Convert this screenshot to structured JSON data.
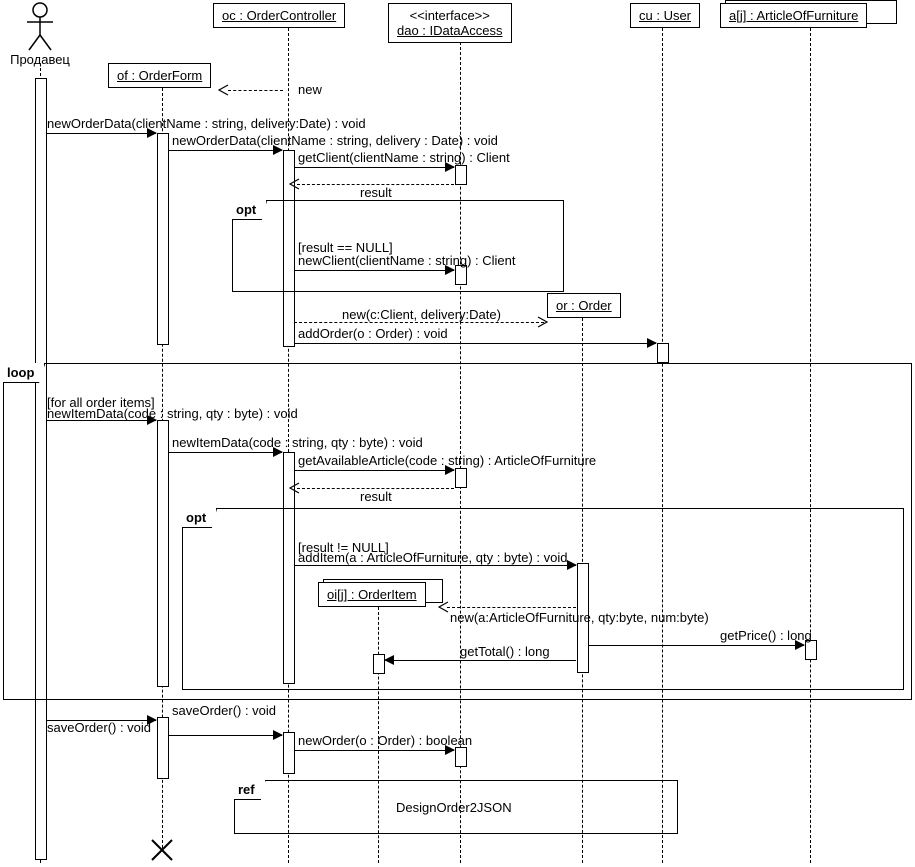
{
  "actor": {
    "label": "Продавец"
  },
  "lifelines": {
    "of": "of : OrderForm",
    "oc": "oc : OrderController",
    "dao_stereo": "<<interface>>",
    "dao": "dao : IDataAccess",
    "or": "or : Order",
    "cu": "cu : User",
    "aj": "a[j] : ArticleOfFurniture",
    "oij": "oi[j] : OrderItem"
  },
  "messages": {
    "m_new_of": "new",
    "m_newOrderData1": "newOrderData(clientName : string, delivery:Date) : void",
    "m_newOrderData2": "newOrderData(clientName : string, delivery : Date) : void",
    "m_getClient": "getClient(clientName : string) : Client",
    "m_result1": "result",
    "m_newClient": "newClient(clientName : string) : Client",
    "m_newOrder": "new(c:Client, delivery:Date)",
    "m_addOrder": "addOrder(o : Order) : void",
    "m_newItemData1": "newItemData(code : string, qty : byte) : void",
    "m_newItemData2": "newItemData(code : string, qty : byte) : void",
    "m_getAvailArt": "getAvailableArticle(code : string) : ArticleOfFurniture",
    "m_result2": "result",
    "m_addItem": "addItem(a : ArticleOfFurniture, qty : byte) : void",
    "m_newOI": "new(a:ArticleOfFurniture, qty:byte, num:byte)",
    "m_getPrice": "getPrice() : long",
    "m_getTotal": "getTotal() : long",
    "m_saveOrder1": "saveOrder() : void",
    "m_saveOrder2": "saveOrder() : void",
    "m_newOrderDao": "newOrder(o : Order) : boolean"
  },
  "frames": {
    "opt1_label": "opt",
    "opt1_guard": "[result == NULL]",
    "loop_label": "loop",
    "loop_guard": "[for all order items]",
    "opt2_label": "opt",
    "opt2_guard": "[result != NULL]",
    "ref_label": "ref",
    "ref_text": "DesignOrder2JSON"
  }
}
